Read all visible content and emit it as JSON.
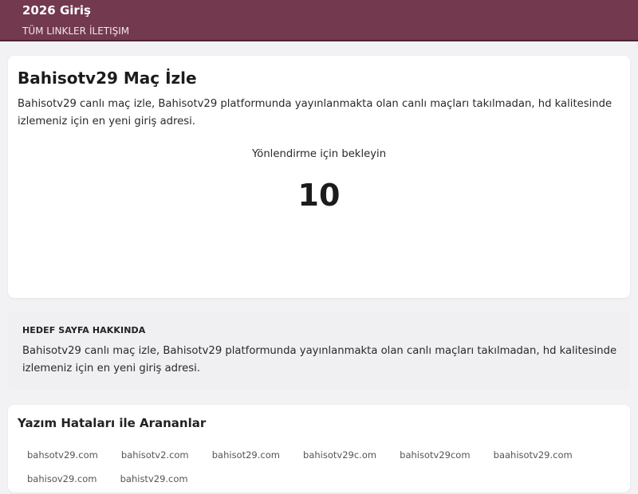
{
  "header": {
    "site_title": "2026 Giriş",
    "nav": [
      {
        "label": "TÜM LINKLER"
      },
      {
        "label": "İLETIŞIM"
      }
    ]
  },
  "main": {
    "heading": "Bahisotv29 Maç İzle",
    "description": "Bahisotv29 canlı maç izle, Bahisotv29 platformunda yayınlanmakta olan canlı maçları takılmadan, hd kalitesinde izlemeniz için en yeni giriş adresi.",
    "redirect_label": "Yönlendirme için bekleyin",
    "countdown": "10"
  },
  "about": {
    "label": "HEDEF SAYFA HAKKINDA",
    "description": "Bahisotv29 canlı maç izle, Bahisotv29 platformunda yayınlanmakta olan canlı maçları takılmadan, hd kalitesinde izlemeniz için en yeni giriş adresi."
  },
  "typos": {
    "heading": "Yazım Hataları ile Arananlar",
    "items": [
      "bahsotv29.com",
      "bahisotv2.com",
      "bahisot29.com",
      "bahisotv29c.om",
      "bahisotv29com",
      "baahisotv29.com",
      "bahisov29.com",
      "bahistv29.com"
    ]
  },
  "colors": {
    "header_bg": "#73394f",
    "page_bg": "#f2f2f4",
    "card_bg": "#ffffff",
    "about_bg": "#f0eff2"
  }
}
